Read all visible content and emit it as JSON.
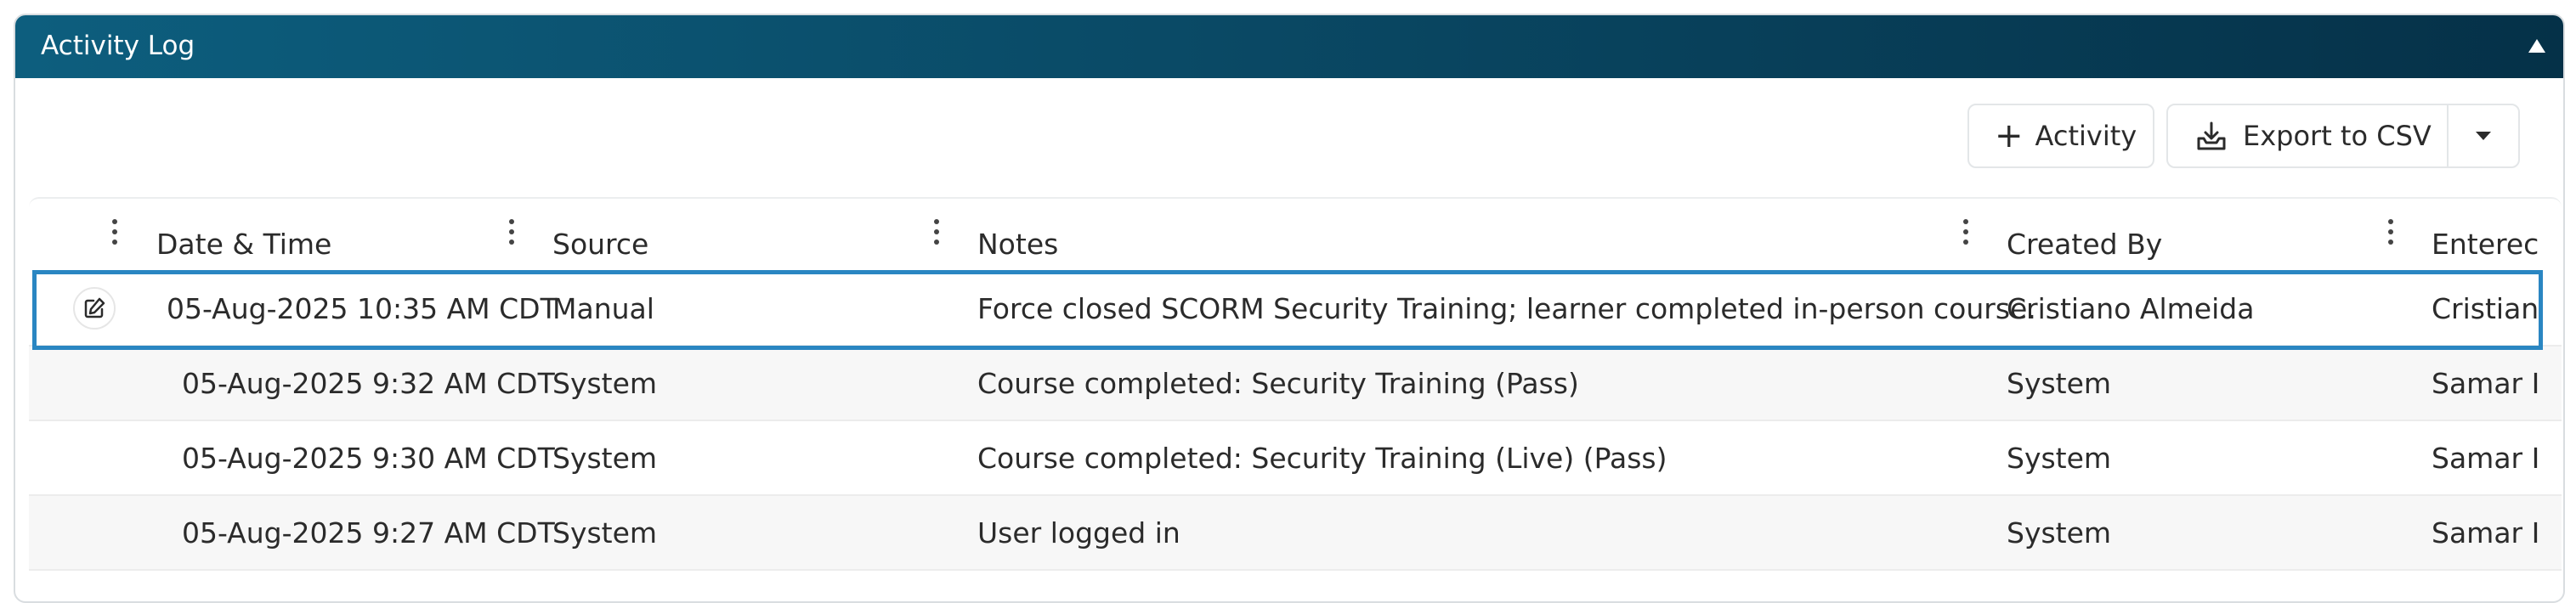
{
  "panel": {
    "title": "Activity Log",
    "collapse_icon": "triangle-up-icon"
  },
  "toolbar": {
    "activity_label": "Activity",
    "activity_icon": "plus-icon",
    "export_label": "Export to CSV",
    "export_icon": "download-tray-icon",
    "export_menu_icon": "caret-down-icon"
  },
  "table": {
    "columns": [
      {
        "key": "datetime",
        "label": "Date & Time"
      },
      {
        "key": "source",
        "label": "Source"
      },
      {
        "key": "notes",
        "label": "Notes"
      },
      {
        "key": "created_by",
        "label": "Created By"
      },
      {
        "key": "entered",
        "label": "Enterec"
      }
    ],
    "rows": [
      {
        "datetime": "05-Aug-2025 10:35 AM CDT",
        "source": "Manual",
        "notes": "Force closed SCORM Security Training; learner completed in-person course.",
        "created_by": "Cristiano Almeida",
        "entered": "Cristian",
        "editable": true,
        "selected": true
      },
      {
        "datetime": "05-Aug-2025 9:32 AM CDT",
        "source": "System",
        "notes": "Course completed: Security Training (Pass)",
        "created_by": "System",
        "entered": "Samar I"
      },
      {
        "datetime": "05-Aug-2025 9:30 AM CDT",
        "source": "System",
        "notes": "Course completed: Security Training (Live) (Pass)",
        "created_by": "System",
        "entered": "Samar I"
      },
      {
        "datetime": "05-Aug-2025 9:27 AM CDT",
        "source": "System",
        "notes": "User logged in",
        "created_by": "System",
        "entered": "Samar I"
      }
    ]
  },
  "colors": {
    "header_start": "#0d5e7e",
    "header_end": "#053148",
    "selection_border": "#2a86c2"
  }
}
